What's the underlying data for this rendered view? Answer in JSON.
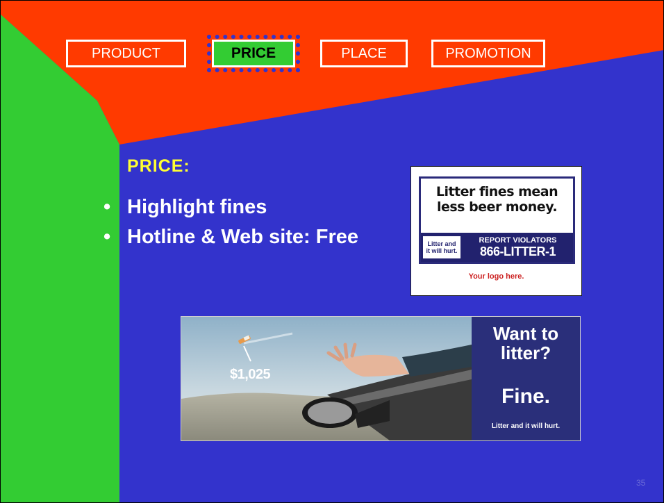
{
  "nav": {
    "product": "PRODUCT",
    "price": "PRICE",
    "place": "PLACE",
    "promotion": "PROMOTION"
  },
  "content": {
    "heading": "PRICE:",
    "bullets": [
      "Highlight fines",
      "Hotline & Web site: Free"
    ]
  },
  "ad1": {
    "headline_line1": "Litter fines mean",
    "headline_line2": "less beer money.",
    "strip_left_line1": "Litter and",
    "strip_left_line2": "it will hurt.",
    "strip_right_top": "REPORT VIOLATORS",
    "strip_right_number": "866-LITTER-1",
    "logo_line": "Your logo here."
  },
  "ad2": {
    "price_tag": "$1,025",
    "question_line1": "Want to",
    "question_line2": "litter?",
    "fine_text": "Fine.",
    "footer": "Litter and it will hurt."
  },
  "page_number": "35",
  "colors": {
    "background_blue": "#3333cc",
    "header_red": "#ff3a00",
    "left_green": "#33cc33",
    "heading_yellow": "#ffff33"
  }
}
